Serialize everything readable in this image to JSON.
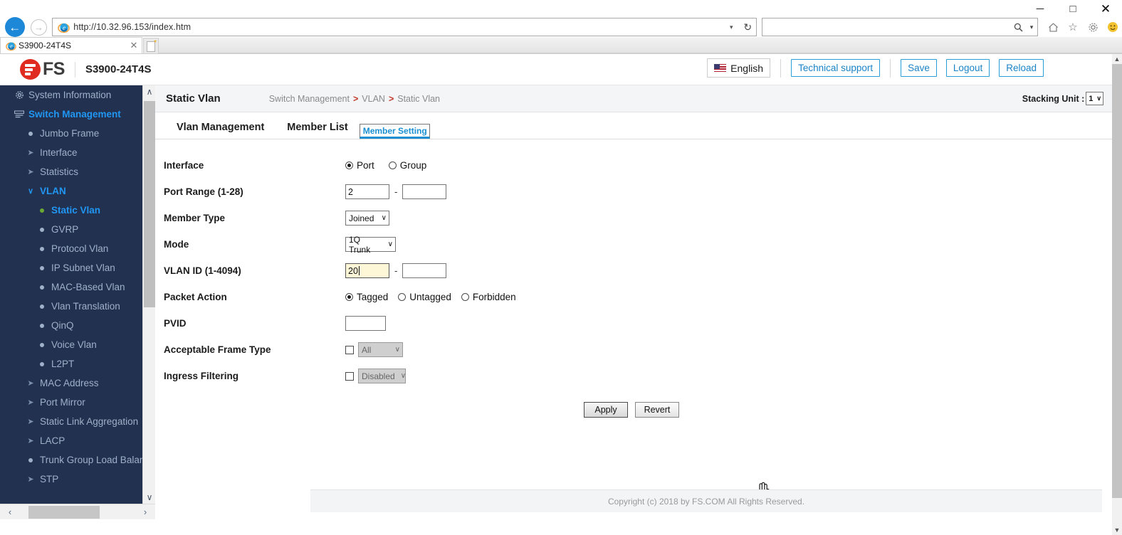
{
  "browser": {
    "window_controls": {
      "minimize": "─",
      "maximize": "□",
      "close": "✕"
    },
    "back_icon": "←",
    "forward_icon": "→",
    "address_value": "http://10.32.96.153/index.htm",
    "address_dropdown_icon": "▾",
    "refresh_icon": "↻",
    "search_value": "",
    "search_icon": "🔍",
    "search_dropdown_icon": "▾",
    "home_icon": "⌂",
    "favorites_icon": "☆",
    "settings_icon": "⚙",
    "smiley_icon": "☺",
    "tab_label": "S3900-24T4S",
    "tab_close_icon": "✕",
    "new_tab_icon": "*"
  },
  "header": {
    "brand": "FS",
    "model": "S3900-24T4S",
    "language": "English",
    "technical_support": "Technical support",
    "save": "Save",
    "logout": "Logout",
    "reload": "Reload"
  },
  "sidebar": {
    "scroll_up_icon": "∧",
    "scroll_down_icon": "∨",
    "hscroll_left_icon": "‹",
    "hscroll_right_icon": "›",
    "items": [
      {
        "label": "System Information",
        "level": 1,
        "icon": "gear-icon",
        "active": false
      },
      {
        "label": "Switch Management",
        "level": 1,
        "icon": "bars-icon",
        "active": true
      },
      {
        "label": "Jumbo Frame",
        "level": 2,
        "icon": "dot-icon",
        "active": false
      },
      {
        "label": "Interface",
        "level": 2,
        "icon": "arrow-right-icon",
        "active": false
      },
      {
        "label": "Statistics",
        "level": 2,
        "icon": "arrow-right-icon",
        "active": false
      },
      {
        "label": "VLAN",
        "level": 2,
        "icon": "chevron-down-icon",
        "active": true
      },
      {
        "label": "Static Vlan",
        "level": 3,
        "icon": "dot-green-icon",
        "active": true
      },
      {
        "label": "GVRP",
        "level": 3,
        "icon": "dot-icon",
        "active": false
      },
      {
        "label": "Protocol Vlan",
        "level": 3,
        "icon": "dot-icon",
        "active": false
      },
      {
        "label": "IP Subnet Vlan",
        "level": 3,
        "icon": "dot-icon",
        "active": false
      },
      {
        "label": "MAC-Based Vlan",
        "level": 3,
        "icon": "dot-icon",
        "active": false
      },
      {
        "label": "Vlan Translation",
        "level": 3,
        "icon": "dot-icon",
        "active": false
      },
      {
        "label": "QinQ",
        "level": 3,
        "icon": "dot-icon",
        "active": false
      },
      {
        "label": "Voice Vlan",
        "level": 3,
        "icon": "dot-icon",
        "active": false
      },
      {
        "label": "L2PT",
        "level": 3,
        "icon": "dot-icon",
        "active": false
      },
      {
        "label": "MAC Address",
        "level": 2,
        "icon": "arrow-right-icon",
        "active": false
      },
      {
        "label": "Port Mirror",
        "level": 2,
        "icon": "arrow-right-icon",
        "active": false
      },
      {
        "label": "Static Link Aggregation",
        "level": 2,
        "icon": "arrow-right-icon",
        "active": false
      },
      {
        "label": "LACP",
        "level": 2,
        "icon": "arrow-right-icon",
        "active": false
      },
      {
        "label": "Trunk Group Load Balance",
        "level": 2,
        "icon": "dot-icon",
        "active": false
      },
      {
        "label": "STP",
        "level": 2,
        "icon": "arrow-right-icon",
        "active": false
      }
    ]
  },
  "main": {
    "page_title": "Static Vlan",
    "breadcrumb": {
      "root": "Switch Management",
      "mid": "VLAN",
      "leaf": "Static Vlan",
      "separator": ">"
    },
    "stacking_unit": {
      "label": "Stacking Unit :",
      "value": "1",
      "chevron": "∨"
    },
    "tabs": [
      {
        "label": "Vlan Management",
        "selected": false
      },
      {
        "label": "Member List",
        "selected": false
      },
      {
        "label": "Member Setting",
        "selected": true
      }
    ],
    "form": {
      "interface": {
        "label": "Interface",
        "options": [
          {
            "label": "Port",
            "selected": true
          },
          {
            "label": "Group",
            "selected": false
          }
        ]
      },
      "port_range": {
        "label": "Port Range (1-28)",
        "from": "2",
        "to": "",
        "dash": "-"
      },
      "member_type": {
        "label": "Member Type",
        "value": "Joined",
        "chevron": "∨"
      },
      "mode": {
        "label": "Mode",
        "value": "1Q Trunk",
        "chevron": "∨"
      },
      "vlan_id": {
        "label": "VLAN ID (1-4094)",
        "from": "20",
        "to": "",
        "dash": "-"
      },
      "packet_action": {
        "label": "Packet Action",
        "options": [
          {
            "label": "Tagged",
            "selected": true
          },
          {
            "label": "Untagged",
            "selected": false
          },
          {
            "label": "Forbidden",
            "selected": false
          }
        ]
      },
      "pvid": {
        "label": "PVID",
        "value": ""
      },
      "acceptable_frame_type": {
        "label": "Acceptable Frame Type",
        "checked": false,
        "value": "All",
        "chevron": "∨"
      },
      "ingress_filtering": {
        "label": "Ingress Filtering",
        "checked": false,
        "value": "Disabled",
        "chevron": "∨"
      },
      "apply_button": "Apply",
      "revert_button": "Revert"
    }
  },
  "footer": {
    "copyright": "Copyright (c) 2018 by FS.COM All Rights Reserved."
  },
  "page_scrollbar": {
    "up_icon": "▲",
    "down_icon": "▼"
  },
  "colors": {
    "sidebar_bg": "#21314f",
    "accent_blue": "#2196f3",
    "brand_red": "#e02b20",
    "tab_active": "#1a8fd1",
    "focus_field": "#fdf7d8"
  }
}
